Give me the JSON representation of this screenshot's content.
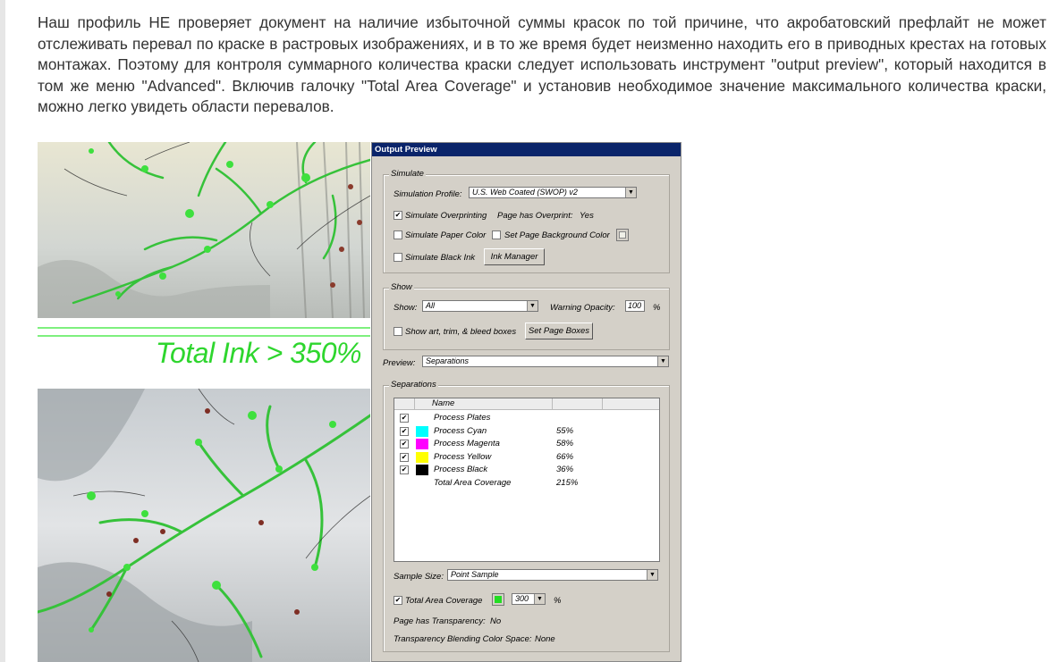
{
  "article": {
    "text": "Наш профиль НЕ проверяет документ на наличие избыточной суммы красок по той причине, что акробатовский префлайт не может отслеживать перевал по краске в растровых изображениях, и в то же время будет неизменно находить его в приводных крестах на готовых монтажах. Поэтому для контроля суммарного количества краски следует использовать инструмент \"output preview\", который находится в том же меню \"Advanced\". Включив галочку \"Total Area Coverage\" и установив необходимое значение максимального количества краски, можно легко увидеть области перевалов."
  },
  "figure": {
    "ink_label": "Total Ink > 350%"
  },
  "dialog": {
    "title": "Output Preview",
    "simulate": {
      "group_title": "Simulate",
      "profile_label": "Simulation Profile:",
      "profile_value": "U.S. Web Coated (SWOP) v2",
      "overprint_label": "Simulate Overprinting",
      "overprint_checked": true,
      "page_overprint_label": "Page has Overprint:",
      "page_overprint_value": "Yes",
      "paper_color_label": "Simulate Paper Color",
      "page_bg_label": "Set Page Background Color",
      "black_ink_label": "Simulate Black Ink",
      "ink_manager_label": "Ink Manager"
    },
    "show": {
      "group_title": "Show",
      "show_label": "Show:",
      "show_value": "All",
      "opacity_label": "Warning Opacity:",
      "opacity_value": "100",
      "opacity_unit": "%",
      "boxes_label": "Show art, trim, & bleed boxes",
      "set_boxes_label": "Set Page Boxes"
    },
    "preview": {
      "label": "Preview:",
      "value": "Separations"
    },
    "separations": {
      "group_title": "Separations",
      "name_header": "Name",
      "rows": [
        {
          "name": "Process Plates",
          "percent": "",
          "checked": true,
          "color": ""
        },
        {
          "name": "Process Cyan",
          "percent": "55%",
          "checked": true,
          "color": "#00ffff"
        },
        {
          "name": "Process Magenta",
          "percent": "58%",
          "checked": true,
          "color": "#ff00ff"
        },
        {
          "name": "Process Yellow",
          "percent": "66%",
          "checked": true,
          "color": "#ffff00"
        },
        {
          "name": "Process Black",
          "percent": "36%",
          "checked": true,
          "color": "#000000"
        },
        {
          "name": "Total Area Coverage",
          "percent": "215%",
          "checked": false,
          "color": ""
        }
      ],
      "sample_size_label": "Sample Size:",
      "sample_size_value": "Point Sample",
      "tac_label": "Total Area Coverage",
      "tac_checked": true,
      "tac_color": "#22dd22",
      "tac_value": "300",
      "tac_unit": "%",
      "transparency_label": "Page has Transparency:",
      "transparency_value": "No",
      "blend_label": "Transparency Blending Color Space:",
      "blend_value": "None"
    }
  }
}
